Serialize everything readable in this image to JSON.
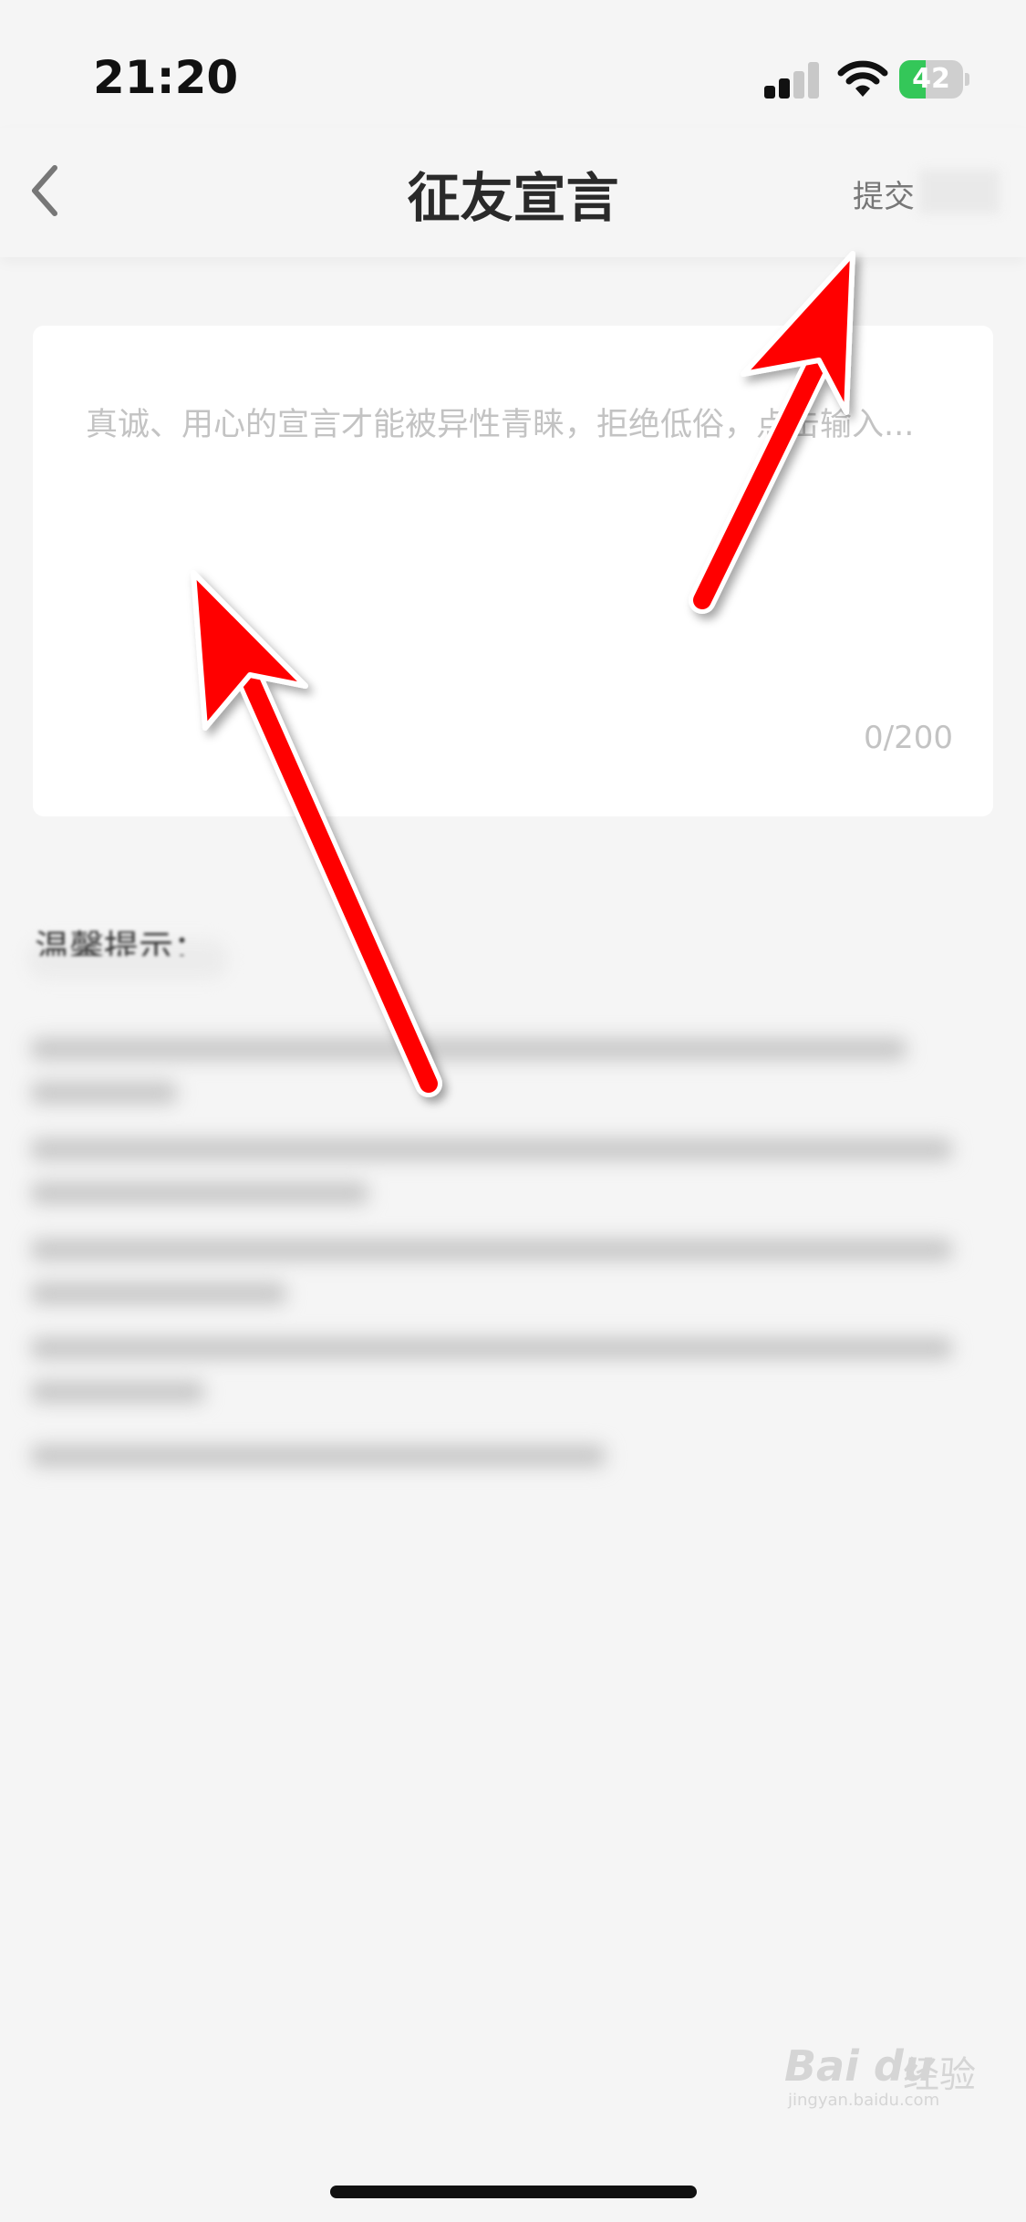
{
  "status_bar": {
    "time": "21:20",
    "battery_level": 42,
    "battery_label": "42",
    "battery_color": "#34c759",
    "signal_bars_active": 2,
    "icons": [
      "cellular-signal-icon",
      "wifi-icon",
      "battery-charging-icon"
    ]
  },
  "nav": {
    "back_icon": "chevron-left-icon",
    "title": "征友宣言",
    "submit_label": "提交"
  },
  "declaration": {
    "placeholder": "真诚、用心的宣言才能被异性青睐，拒绝低俗，点击输入...",
    "value": "",
    "counter": "0/200"
  },
  "tips": {
    "title": "温馨提示："
  },
  "annotations": {
    "arrow_color": "#ff0000",
    "arrows": [
      "arrow-to-submit",
      "arrow-to-input"
    ]
  },
  "watermark": {
    "logo": "Bai du",
    "cn": "经验",
    "url": "jingyan.baidu.com"
  }
}
